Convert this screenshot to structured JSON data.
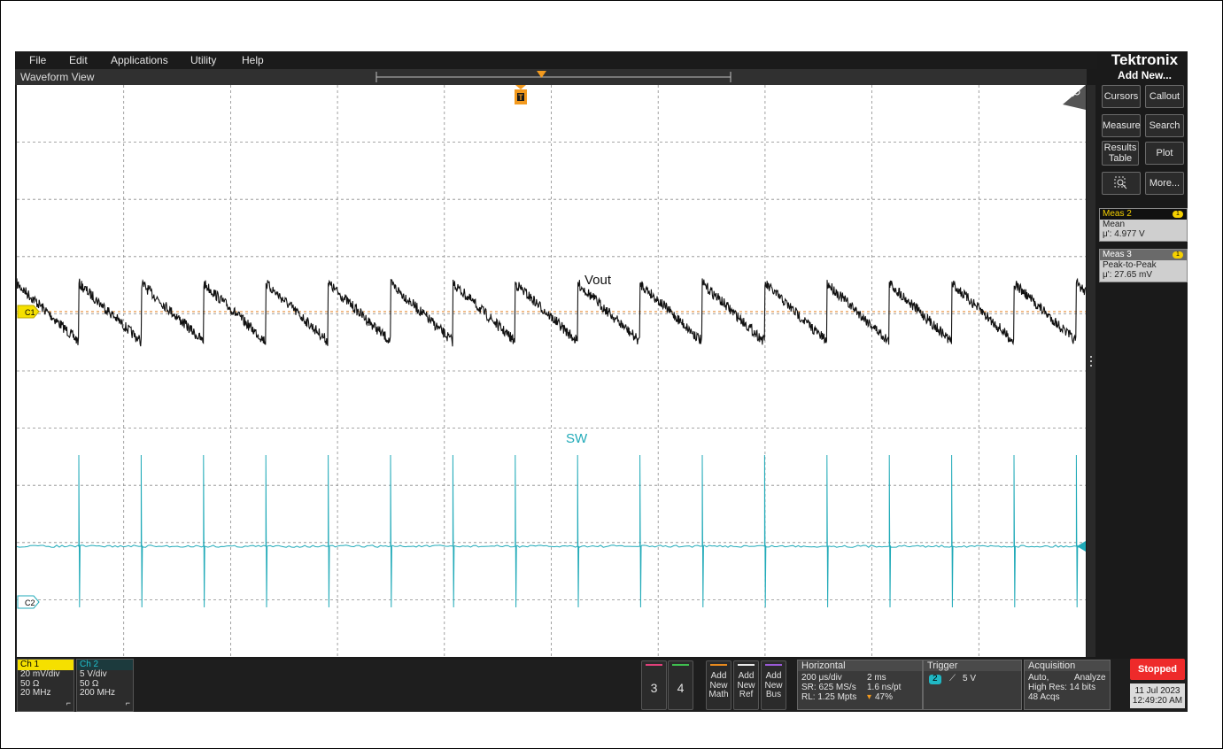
{
  "menu": [
    "File",
    "Edit",
    "Applications",
    "Utility",
    "Help"
  ],
  "brand": "Tektronix",
  "waveform_view": {
    "title": "Waveform View",
    "trigger_marker": "T",
    "trace_labels": {
      "ch1": "Vout",
      "ch2": "SW"
    },
    "channel_markers": {
      "ch1": "C1",
      "ch2": "C2"
    }
  },
  "right_panel": {
    "add_new": "Add New...",
    "buttons": [
      "Cursors",
      "Callout",
      "Measure",
      "Search",
      "Results Table",
      "Plot",
      "More..."
    ],
    "measurements": [
      {
        "title": "Meas 2",
        "badge": "1",
        "type": "Mean",
        "value": "μ': 4.977 V"
      },
      {
        "title": "Meas 3",
        "badge": "1",
        "type": "Peak-to-Peak",
        "value": "μ': 27.65 mV"
      }
    ]
  },
  "channels": [
    {
      "name": "Ch 1",
      "scale": "20 mV/div",
      "impedance": "50 Ω",
      "bandwidth": "20 MHz",
      "color": "#f5e000"
    },
    {
      "name": "Ch 2",
      "scale": "5 V/div",
      "impedance": "50 Ω",
      "bandwidth": "200 MHz",
      "color": "#20b8c4"
    }
  ],
  "slots": {
    "ch3": "3",
    "ch4": "4",
    "math": "Add New Math",
    "ref": "Add New Ref",
    "bus": "Add New Bus"
  },
  "horizontal": {
    "title": "Horizontal",
    "scale": "200 μs/div",
    "record_time": "2 ms",
    "sample_rate": "SR: 625 MS/s",
    "resolution": "1.6 ns/pt",
    "record_length": "RL: 1.25 Mpts",
    "position": "47%"
  },
  "trigger": {
    "title": "Trigger",
    "source": "2",
    "level": "5 V"
  },
  "acquisition": {
    "title": "Acquisition",
    "mode": "Auto,",
    "analyze": "Analyze",
    "resolution": "High Res: 14 bits",
    "acqs": "48 Acqs"
  },
  "status": {
    "run_state": "Stopped",
    "date": "11 Jul 2023",
    "time": "12:49:20 AM"
  },
  "colors": {
    "ch1_trace": "#111111",
    "ch2_trace": "#20aab8",
    "run_state": "#ee2a2a",
    "ch1_label": "#f5e000"
  }
}
